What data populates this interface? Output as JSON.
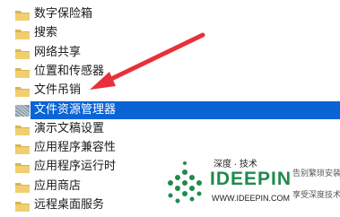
{
  "tree": {
    "items": [
      {
        "label": "数字保险箱",
        "selected": false
      },
      {
        "label": "搜索",
        "selected": false
      },
      {
        "label": "网络共享",
        "selected": false
      },
      {
        "label": "位置和传感器",
        "selected": false
      },
      {
        "label": "文件吊销",
        "selected": false
      },
      {
        "label": "文件资源管理器",
        "selected": true
      },
      {
        "label": "演示文稿设置",
        "selected": false
      },
      {
        "label": "应用程序兼容性",
        "selected": false
      },
      {
        "label": "应用程序运行时",
        "selected": false
      },
      {
        "label": "应用商店",
        "selected": false
      },
      {
        "label": "远程桌面服务",
        "selected": false
      }
    ]
  },
  "colors": {
    "selection": "#0a64d6",
    "arrow": "#e8303a",
    "folder": "#e9c46a",
    "watermark_green": "#1f8a4c",
    "watermark_text": "#2a2a2a"
  },
  "watermark": {
    "title": "深度 · 技术",
    "brand": "IDEEPIN",
    "url": "WWW.IDEEPIN.COM",
    "slogan1": "告别繁琐安装",
    "slogan2": "享受深度技术"
  }
}
